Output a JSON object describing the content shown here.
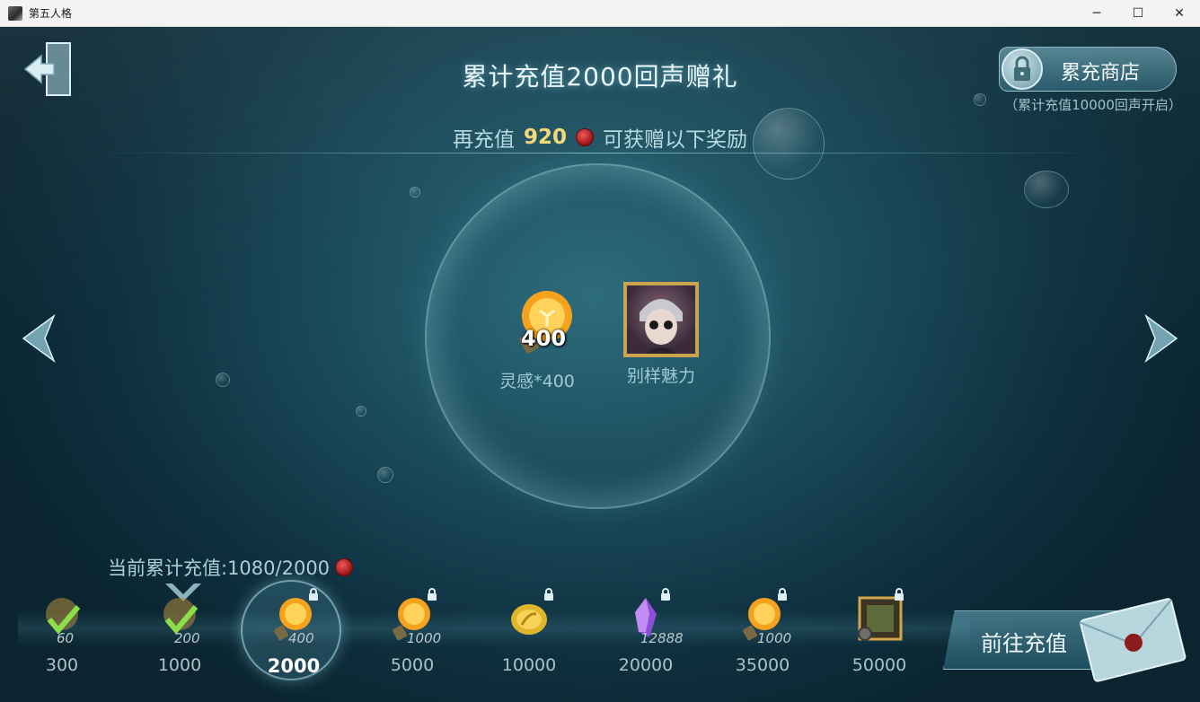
{
  "window": {
    "title": "第五人格",
    "controls": {
      "minimize": "─",
      "maximize": "☐",
      "close": "✕"
    }
  },
  "header": {
    "title": "累计充值2000回声赠礼",
    "subtitle_prefix": "再充值",
    "subtitle_amount": "920",
    "subtitle_suffix": "可获赠以下奖励"
  },
  "shop": {
    "label": "累充商店",
    "note": "（累计充值10000回声开启）"
  },
  "rewards": [
    {
      "icon": "lightbulb-inspiration-icon",
      "count": "400",
      "label": "灵感*400"
    },
    {
      "icon": "character-portrait-icon",
      "label": "别样魅力"
    }
  ],
  "progress": {
    "label": "当前累计充值:1080/2000"
  },
  "tiers": [
    {
      "threshold": "300",
      "count": "60",
      "icon": "lightbulb-icon",
      "state": "claimed"
    },
    {
      "threshold": "1000",
      "count": "200",
      "icon": "lightbulb-icon",
      "state": "claimed"
    },
    {
      "threshold": "2000",
      "count": "400",
      "icon": "lightbulb-icon",
      "state": "active-locked"
    },
    {
      "threshold": "5000",
      "count": "1000",
      "icon": "lightbulb-icon",
      "state": "locked"
    },
    {
      "threshold": "10000",
      "count": "",
      "icon": "gold-feather-coin-icon",
      "state": "locked"
    },
    {
      "threshold": "20000",
      "count": "12888",
      "icon": "purple-crystal-icon",
      "state": "locked"
    },
    {
      "threshold": "35000",
      "count": "1000",
      "icon": "lightbulb-icon",
      "state": "locked"
    },
    {
      "threshold": "50000",
      "count": "",
      "icon": "film-frame-icon",
      "state": "locked"
    }
  ],
  "actions": {
    "go_recharge": "前往充值"
  },
  "colors": {
    "accent_gold": "#f4d878",
    "coin_red": "#c22222",
    "text_light": "#e9f7fb"
  }
}
